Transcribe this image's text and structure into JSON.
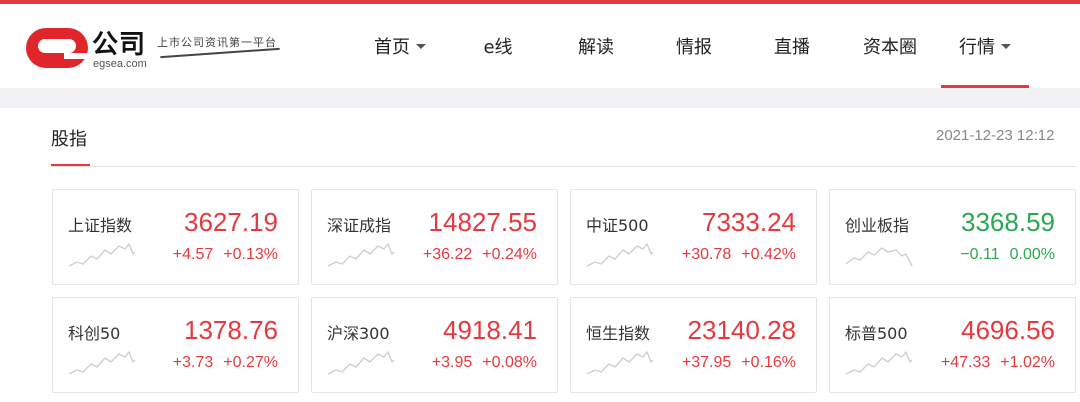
{
  "brand": {
    "name": "公司",
    "domain": "egsea.com",
    "slogan": "上市公司资讯第一平台"
  },
  "nav": [
    {
      "label": "首页",
      "dropdown": true,
      "active": false
    },
    {
      "label": "e线",
      "dropdown": false,
      "active": false
    },
    {
      "label": "解读",
      "dropdown": false,
      "active": false
    },
    {
      "label": "情报",
      "dropdown": false,
      "active": false
    },
    {
      "label": "直播",
      "dropdown": false,
      "active": false
    },
    {
      "label": "资本圈",
      "dropdown": false,
      "active": false
    },
    {
      "label": "行情",
      "dropdown": true,
      "active": true
    }
  ],
  "section": {
    "title": "股指",
    "timestamp": "2021-12-23 12:12"
  },
  "colors": {
    "accent": "#e6393f",
    "up": "#e6393f",
    "down": "#2aa850"
  },
  "indices": [
    {
      "name": "上证指数",
      "price": "3627.19",
      "change": "+4.57",
      "pct": "+0.13%",
      "trend": "up"
    },
    {
      "name": "深证成指",
      "price": "14827.55",
      "change": "+36.22",
      "pct": "+0.24%",
      "trend": "up"
    },
    {
      "name": "中证500",
      "price": "7333.24",
      "change": "+30.78",
      "pct": "+0.42%",
      "trend": "up"
    },
    {
      "name": "创业板指",
      "price": "3368.59",
      "change": "−0.11",
      "pct": "0.00%",
      "trend": "down"
    },
    {
      "name": "科创50",
      "price": "1378.76",
      "change": "+3.73",
      "pct": "+0.27%",
      "trend": "up"
    },
    {
      "name": "沪深300",
      "price": "4918.41",
      "change": "+3.95",
      "pct": "+0.08%",
      "trend": "up"
    },
    {
      "name": "恒生指数",
      "price": "23140.28",
      "change": "+37.95",
      "pct": "+0.16%",
      "trend": "up"
    },
    {
      "name": "标普500",
      "price": "4696.56",
      "change": "+47.33",
      "pct": "+1.02%",
      "trend": "up"
    }
  ]
}
